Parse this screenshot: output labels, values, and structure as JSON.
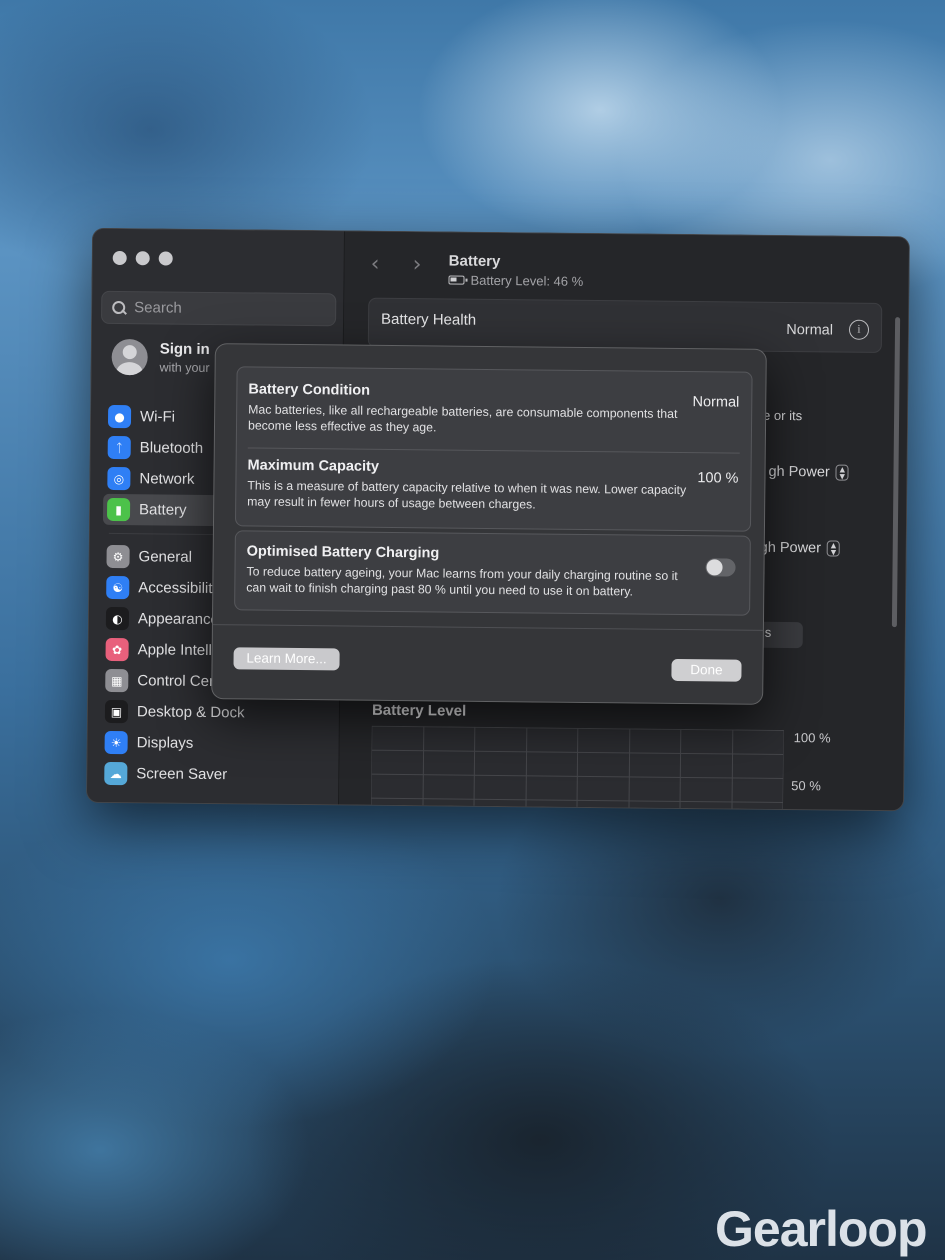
{
  "window": {
    "title": "Battery",
    "subtitle": "Battery Level: 46 %"
  },
  "sidebar": {
    "search_placeholder": "Search",
    "account": {
      "title": "Sign in",
      "subtitle": "with your"
    },
    "items": [
      {
        "label": "Wi-Fi",
        "icon": "wifi-icon",
        "color": "#2f7ff5"
      },
      {
        "label": "Bluetooth",
        "icon": "bluetooth-icon",
        "color": "#2f7ff5"
      },
      {
        "label": "Network",
        "icon": "globe-icon",
        "color": "#2f7ff5"
      },
      {
        "label": "Battery",
        "icon": "battery-icon",
        "color": "#4cc24a",
        "active": true
      },
      {
        "label": "General",
        "icon": "gear-icon",
        "color": "#8e8e93"
      },
      {
        "label": "Accessibility",
        "icon": "accessibility-icon",
        "color": "#2f7ff5"
      },
      {
        "label": "Appearance",
        "icon": "appearance-icon",
        "color": "#1c1c1e"
      },
      {
        "label": "Apple Intelligence",
        "icon": "apple-intelligence-icon",
        "color": "#e8607c"
      },
      {
        "label": "Control Centre",
        "icon": "control-centre-icon",
        "color": "#8e8e93"
      },
      {
        "label": "Desktop & Dock",
        "icon": "desktop-dock-icon",
        "color": "#1c1c1e"
      },
      {
        "label": "Displays",
        "icon": "displays-icon",
        "color": "#2f7ff5"
      },
      {
        "label": "Screen Saver",
        "icon": "screen-saver-icon",
        "color": "#55a8d8"
      }
    ]
  },
  "main": {
    "battery_health_label": "Battery Health",
    "battery_health_value": "Normal",
    "peek_text_1": "e or its",
    "peek_power_1": "gh Power",
    "peek_power_2": "gh Power",
    "peek_text_s": "s",
    "chart_title": "Battery Level"
  },
  "chart_data": {
    "type": "bar",
    "title": "Battery Level",
    "ytick_labels": [
      "100 %",
      "50 %"
    ],
    "ylim": [
      0,
      100
    ],
    "grid": true
  },
  "sheet": {
    "condition_title": "Battery Condition",
    "condition_desc": "Mac batteries, like all rechargeable batteries, are consumable components that become less effective as they age.",
    "condition_value": "Normal",
    "capacity_title": "Maximum Capacity",
    "capacity_desc": "This is a measure of battery capacity relative to when it was new. Lower capacity may result in fewer hours of usage between charges.",
    "capacity_value": "100 %",
    "charging_title": "Optimised Battery Charging",
    "charging_desc": "To reduce battery ageing, your Mac learns from your daily charging routine so it can wait to finish charging past 80 % until you need to use it on battery.",
    "charging_enabled": false,
    "learn_more_label": "Learn More...",
    "done_label": "Done"
  },
  "watermark": "Gearloop"
}
